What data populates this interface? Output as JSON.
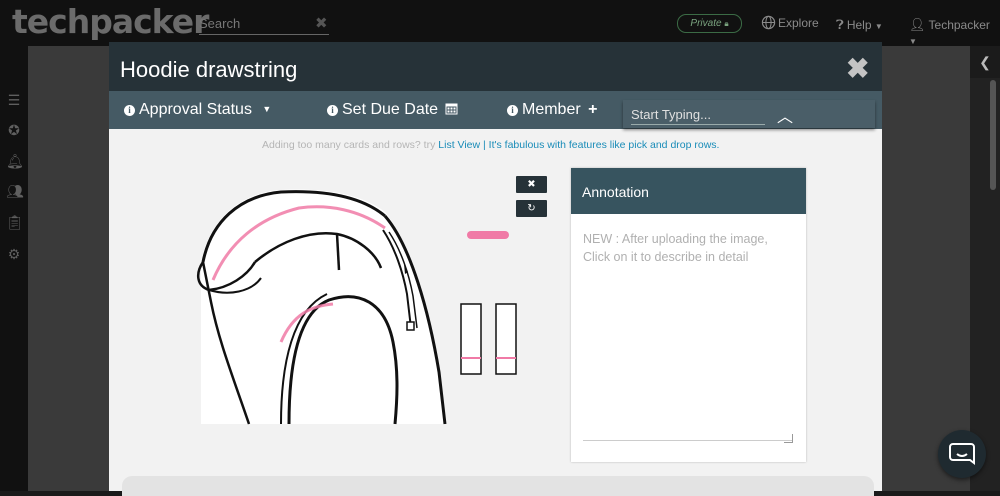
{
  "navbar": {
    "logo": "techpacker",
    "search_placeholder": "Search",
    "private_label": "Private",
    "explore_label": "Explore",
    "help_label": "Help",
    "user_label": "Techpacker"
  },
  "sidebar_icons": [
    "list-icon",
    "star-icon",
    "bell-icon",
    "users-add-icon",
    "clipboard-icon",
    "gear-icon"
  ],
  "modal": {
    "title": "Hoodie drawstring",
    "close_glyph": "✖",
    "toolbar": {
      "approval_label": "Approval Status",
      "due_label": "Set Due Date",
      "member_label": "Member",
      "start_typing_placeholder": "Start Typing..."
    },
    "hint": {
      "prefix": "Adding too many cards and rows? try",
      "link_list_view": "List View",
      "separator": "|",
      "link_features": "It's fabulous with features like pick and drop rows."
    },
    "annotation": {
      "title": "Annotation",
      "placeholder": "NEW : After uploading the image,\nClick on it to describe in detail"
    }
  },
  "colors": {
    "modal_header": "#263238",
    "toolbar": "#455a64",
    "annotation_header": "#37545f",
    "accent_pink": "#f07aa6",
    "link": "#1a8cb8"
  }
}
